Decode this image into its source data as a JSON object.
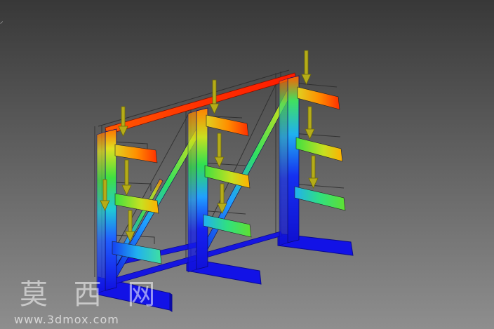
{
  "viewport": {
    "background_top": "#3a3a3a",
    "background_bottom": "#8c8c8c",
    "corner_glyph": "⸝",
    "watermark_text": "莫 西 网",
    "watermark_url": "www.3dmox.com"
  },
  "model": {
    "description_name": "cantilever-rack-fea-stress-plot",
    "load_arrow_color": "#b5ac18",
    "stress_colors": [
      "#1010e0",
      "#1a8cff",
      "#20d0d0",
      "#30e040",
      "#d0e020",
      "#ff8000",
      "#ff2000"
    ],
    "load_arrow_count": 9,
    "column_count": 3
  }
}
